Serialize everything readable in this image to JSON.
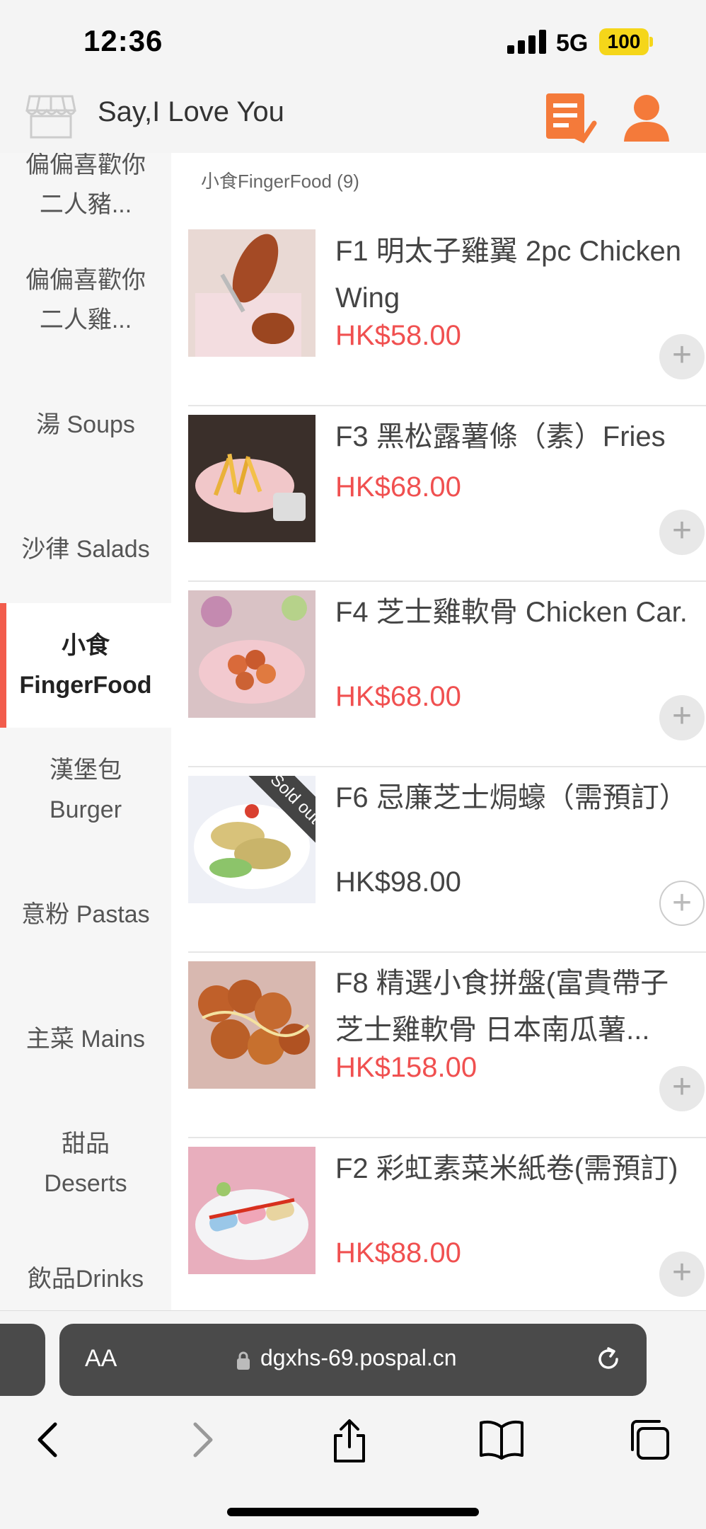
{
  "status": {
    "time": "12:36",
    "network": "5G",
    "battery": "100"
  },
  "header": {
    "shop_name": "Say,I Love You"
  },
  "sidebar": {
    "items": [
      {
        "label": "偏偏喜歡你\n二人豬..."
      },
      {
        "label": "偏偏喜歡你\n二人雞..."
      },
      {
        "label": "湯 Soups"
      },
      {
        "label": "沙律 Salads"
      },
      {
        "label": "小食\nFingerFood",
        "active": true
      },
      {
        "label": "漢堡包\nBurger"
      },
      {
        "label": "意粉 Pastas"
      },
      {
        "label": "主菜 Mains"
      },
      {
        "label": "甜品\nDeserts"
      },
      {
        "label": "飲品Drinks"
      }
    ]
  },
  "main": {
    "category_title": "小食FingerFood (9)",
    "products": [
      {
        "name": "F1 明太子雞翼 2pc Chicken Wing",
        "price": "HK$58.00",
        "sold_out": false
      },
      {
        "name": "F3 黑松露薯條（素）Fries",
        "price": "HK$68.00",
        "sold_out": false
      },
      {
        "name": "F4 芝士雞軟骨 Chicken Car.",
        "price": "HK$68.00",
        "sold_out": false
      },
      {
        "name": "F6 忌廉芝士焗蠔（需預訂）",
        "price": "HK$98.00",
        "sold_out": true,
        "badge": "Sold out"
      },
      {
        "name": "F8 精選小食拼盤(富貴帶子 芝士雞軟骨 日本南瓜薯...",
        "price": "HK$158.00",
        "sold_out": false
      },
      {
        "name": "F2 彩虹素菜米紙卷(需預訂)",
        "price": "HK$88.00",
        "sold_out": false
      }
    ],
    "add_symbol": "+"
  },
  "browser": {
    "aa_label": "AA",
    "url": "dgxhs-69.pospal.cn"
  },
  "colors": {
    "accent": "#f25c4c",
    "price": "#f05050",
    "icon_orange": "#f47a3a"
  }
}
